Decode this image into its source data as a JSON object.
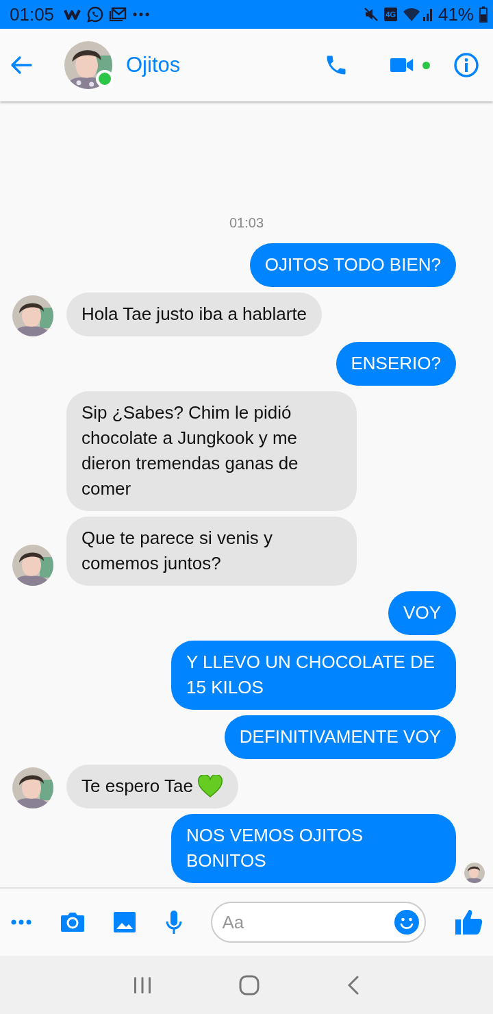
{
  "status_bar": {
    "time": "01:05",
    "network_type": "4G",
    "battery": "41%"
  },
  "header": {
    "name": "Ojitos",
    "online": true,
    "video_available": true
  },
  "chat": {
    "timestamp": "01:03",
    "messages": [
      {
        "kind": "sent",
        "text": "OJITOS TODO BIEN?",
        "avatar": false,
        "heart": false,
        "seen": false
      },
      {
        "kind": "received",
        "text": "Hola Tae justo iba a hablarte",
        "avatar": true,
        "heart": false,
        "seen": false
      },
      {
        "kind": "sent",
        "text": "ENSERIO?",
        "avatar": false,
        "heart": false,
        "seen": false
      },
      {
        "kind": "received",
        "text": "Sip ¿Sabes? Chim le pidió chocolate a Jungkook y me dieron tremendas ganas de comer",
        "avatar": false,
        "heart": false,
        "seen": false
      },
      {
        "kind": "received",
        "text": "Que te parece si venis y comemos juntos?",
        "avatar": true,
        "heart": false,
        "seen": false
      },
      {
        "kind": "sent",
        "text": "VOY",
        "avatar": false,
        "heart": false,
        "seen": false
      },
      {
        "kind": "sent",
        "text": "Y LLEVO UN CHOCOLATE DE 15 KILOS",
        "avatar": false,
        "heart": false,
        "seen": false
      },
      {
        "kind": "sent",
        "text": "DEFINITIVAMENTE VOY",
        "avatar": false,
        "heart": false,
        "seen": false
      },
      {
        "kind": "received",
        "text": "Te espero Tae",
        "avatar": true,
        "heart": true,
        "seen": false
      },
      {
        "kind": "sent",
        "text": "NOS VEMOS OJITOS BONITOS",
        "avatar": false,
        "heart": false,
        "seen": true
      }
    ]
  },
  "composer": {
    "placeholder": "Aa"
  }
}
